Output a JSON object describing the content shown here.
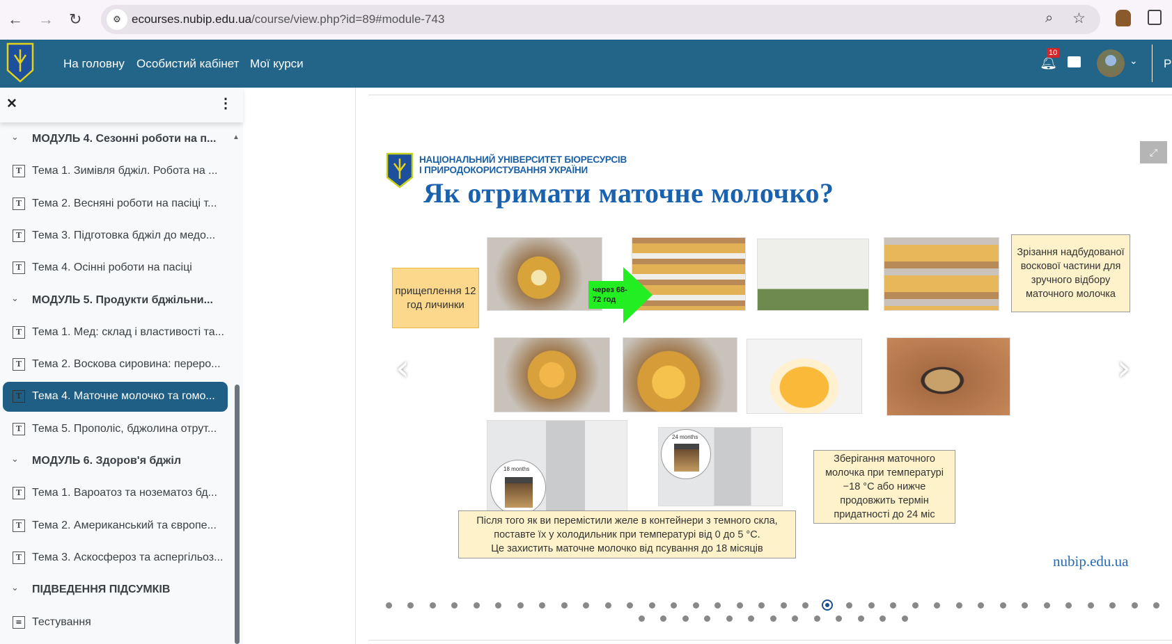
{
  "browser": {
    "url_host": "ecourses.nubip.edu.ua",
    "url_path": "/course/view.php?id=89#module-743"
  },
  "nav": {
    "links": [
      "На головну",
      "Особистий кабінет",
      "Мої курси"
    ],
    "notifications": "10",
    "cut_label": "Р"
  },
  "sidebar": {
    "items": [
      {
        "type": "section",
        "label": "МОДУЛЬ 4. Сезонні роботи на п..."
      },
      {
        "type": "page",
        "label": "Тема 1. Зимівля бджіл. Робота на ..."
      },
      {
        "type": "page",
        "label": "Тема 2. Весняні роботи на пасіці т..."
      },
      {
        "type": "page",
        "label": "Тема 3. Підготовка бджіл до медо..."
      },
      {
        "type": "page",
        "label": "Тема 4. Осінні роботи на пасіці"
      },
      {
        "type": "section",
        "label": "МОДУЛЬ 5. Продукти бджільни..."
      },
      {
        "type": "page",
        "label": "Тема 1. Мед: склад і властивості та..."
      },
      {
        "type": "page",
        "label": "Тема 2. Воскова сировина: переро..."
      },
      {
        "type": "page",
        "label": "Тема 4. Маточне молочко та гомо...",
        "active": true
      },
      {
        "type": "page",
        "label": "Тема 5. Прополіс, бджолина отрут..."
      },
      {
        "type": "section",
        "label": "МОДУЛЬ 6. Здоров'я бджіл"
      },
      {
        "type": "page",
        "label": "Тема 1. Вароатоз та нозематоз бд..."
      },
      {
        "type": "page",
        "label": "Тема 2. Американський та європе..."
      },
      {
        "type": "page",
        "label": "Тема 3. Аскосфероз та аспергільоз..."
      },
      {
        "type": "section",
        "label": "ПІДВЕДЕННЯ ПІДСУМКІВ"
      },
      {
        "type": "quiz",
        "label": "Тестування"
      }
    ]
  },
  "slide": {
    "university_line1": "НАЦІОНАЛЬНИЙ УНІВЕРСИТЕТ БІОРЕСУРСІВ",
    "university_line2": "І ПРИРОДОКОРИСТУВАННЯ УКРАЇНИ",
    "title": "Як отримати маточне молочко?",
    "callout_graft": "прищеплення 12 год личинки",
    "arrow_label": "через 68-72 год",
    "callout_cut": "Зрізання надбудованої воскової частини для зручного відбору маточного молочка",
    "callout_freeze": "Зберігання маточного молочка при температурі −18 °С або нижче продовжить термін придатності до 24 міс",
    "callout_fridge_1": "Після того як ви перемістили желе в контейнери з темного скла,",
    "callout_fridge_2": "поставте їх у холодильник при температурі від 0 до 5 °С.",
    "callout_fridge_3": "Це захистить маточне молочко від псування до 18 місяців",
    "jar_label_18": "18 months",
    "jar_label_24": "24 months",
    "footer_site": "nubip.edu.ua"
  },
  "carousel": {
    "total": 49,
    "active_index": 20
  },
  "colors": {
    "nav": "#236489",
    "active": "#1f5f86",
    "title": "#1a62ad",
    "callout_orange": "#fbd88c",
    "callout_light": "#fdf2c9",
    "arrow_green": "#22ee22"
  }
}
